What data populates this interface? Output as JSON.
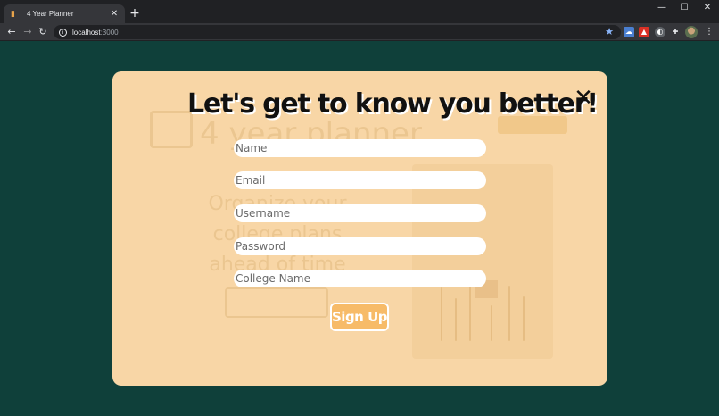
{
  "browser": {
    "tab_title": "4 Year Planner",
    "tab_close_glyph": "✕",
    "new_tab_glyph": "+",
    "url_host": "localhost",
    "url_port": ":3000",
    "window_controls": {
      "minimize": "—",
      "maximize": "☐",
      "close": "✕"
    },
    "nav": {
      "back": "←",
      "forward": "→",
      "reload": "↻"
    },
    "icons": [
      "star-icon",
      "extension-cloud-icon",
      "extension-pdf-icon",
      "extension-shield-icon",
      "puzzle-icon",
      "profile-avatar",
      "kebab-menu-icon"
    ],
    "accent_color": "#8ab4f8"
  },
  "background_page": {
    "title": "4 year planner",
    "tagline": "Organize your college plans ahead of time"
  },
  "modal": {
    "heading": "Let's get to know you better!",
    "close_glyph": "✕",
    "fields": [
      {
        "name": "name",
        "placeholder": "Name"
      },
      {
        "name": "email",
        "placeholder": "Email"
      },
      {
        "name": "username",
        "placeholder": "Username"
      },
      {
        "name": "password",
        "placeholder": "Password"
      },
      {
        "name": "college",
        "placeholder": "College Name"
      }
    ],
    "submit_label": "Sign Up",
    "colors": {
      "modal_bg": "#f8d6a6",
      "button_bg": "#f7bb68",
      "page_bg": "#0f403a"
    }
  }
}
